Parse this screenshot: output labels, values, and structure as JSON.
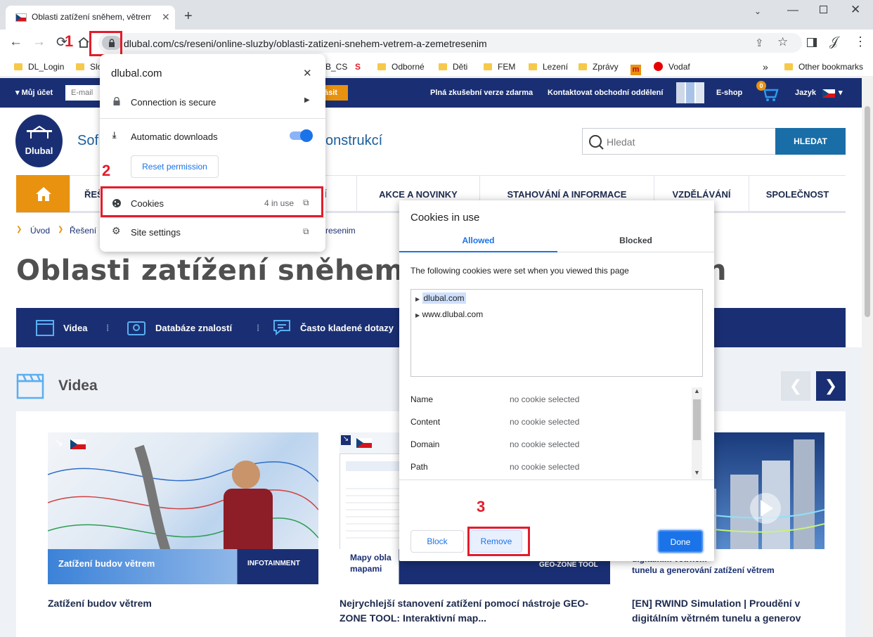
{
  "browser": {
    "tab_title": "Oblasti zatížení sněhem, větrem a",
    "url": "dlubal.com/cs/reseni/online-sluzby/oblasti-zatizeni-snehem-vetrem-a-zemetresenim",
    "bookmarks": [
      "DL_Login",
      "Slo",
      "B_CS",
      "Odborné",
      "Děti",
      "FEM",
      "Lezení",
      "Zprávy",
      "Vodaf"
    ],
    "other_bookmarks": "Other bookmarks",
    "more": "»"
  },
  "site_info_popup": {
    "domain": "dlubal.com",
    "connection": "Connection is secure",
    "auto_downloads": "Automatic downloads",
    "reset_permission": "Reset permission",
    "cookies": "Cookies",
    "cookies_count": "4 in use",
    "site_settings": "Site settings",
    "toggle_on": true
  },
  "cookies_dialog": {
    "title": "Cookies in use",
    "tab_allowed": "Allowed",
    "tab_blocked": "Blocked",
    "description": "The following cookies were set when you viewed this page",
    "tree": [
      "dlubal.com",
      "www.dlubal.com"
    ],
    "details": [
      {
        "key": "Name",
        "value": "no cookie selected"
      },
      {
        "key": "Content",
        "value": "no cookie selected"
      },
      {
        "key": "Domain",
        "value": "no cookie selected"
      },
      {
        "key": "Path",
        "value": "no cookie selected"
      }
    ],
    "block": "Block",
    "remove": "Remove",
    "done": "Done"
  },
  "annotations": {
    "step1": "1",
    "step2": "2",
    "step3": "3"
  },
  "site": {
    "my_account": "Můj účet",
    "email_placeholder": "E-mail",
    "login_btn": "ásit",
    "trial": "Plná zkušební verze zdarma",
    "contact": "Kontaktovat obchodní oddělení",
    "eshop": "E-shop",
    "cart_count": "0",
    "language": "Jazyk",
    "logo_text": "Dlubal",
    "tagline_left": "Sof",
    "tagline_right": "onstrukcí",
    "search_placeholder": "Hledat",
    "search_btn": "HLEDAT",
    "nav": [
      "ŘEŠ",
      "Í",
      "AKCE A NOVINKY",
      "STAHOVÁNÍ A INFORMACE",
      "VZDĚLÁVÁNÍ",
      "SPOLEČNOST"
    ],
    "breadcrumb": [
      "Úvod",
      "Řešení",
      "resenim"
    ],
    "page_title_left": "Oblasti zatížení sněhem, v",
    "page_title_right": "n",
    "band": [
      "Videa",
      "Databáze znalostí",
      "Často kladené dotazy"
    ],
    "section_title": "Videa",
    "cards": [
      {
        "title": "Zatížení budov větrem",
        "caption": "Zatížení budov větrem",
        "tag": "INFOTAINMENT"
      },
      {
        "title": "Nejrychlejší stanovení zatížení pomocí nástroje GEO-ZONE TOOL: Interaktivní map...",
        "caption": "Mapy obla\nmapami",
        "tag": "GEO-ZONE TOOL"
      },
      {
        "title": "[EN] RWIND Simulation | Proudění v digitálním větrném tunelu a generov",
        "caption": "digitálním větrném\ntunelu a generování zatížení větrem",
        "tag": ""
      }
    ]
  },
  "colors": {
    "navy": "#1a2f73",
    "orange": "#e8920f",
    "red": "#e31c2a",
    "chrome_blue": "#1a73e8"
  }
}
